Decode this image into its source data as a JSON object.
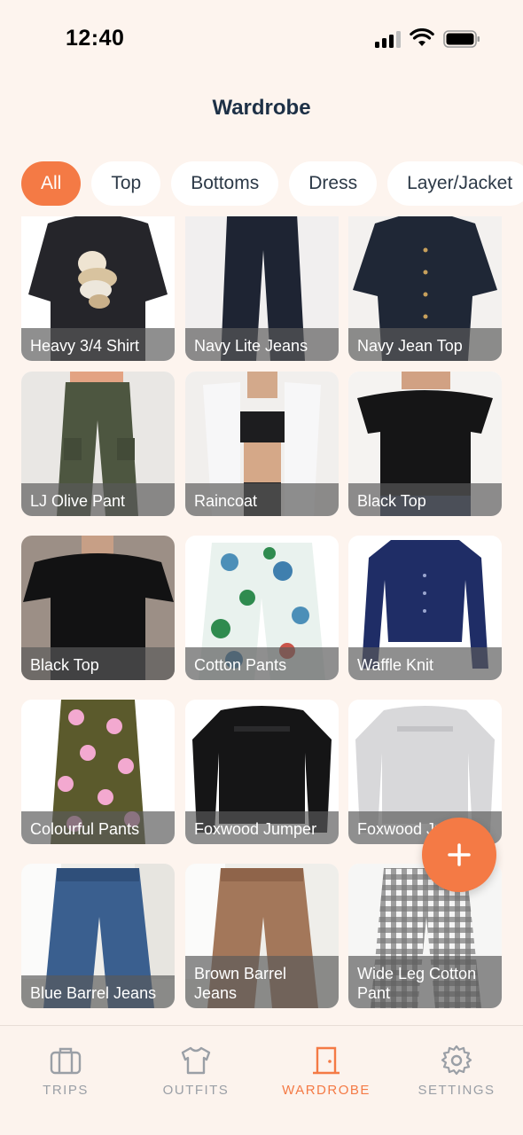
{
  "status_bar": {
    "time": "12:40"
  },
  "header": {
    "title": "Wardrobe"
  },
  "filters": [
    {
      "label": "All",
      "active": true
    },
    {
      "label": "Top",
      "active": false
    },
    {
      "label": "Bottoms",
      "active": false
    },
    {
      "label": "Dress",
      "active": false
    },
    {
      "label": "Layer/Jacket",
      "active": false
    }
  ],
  "items": [
    {
      "name": "Heavy 3/4 Shirt"
    },
    {
      "name": "Navy Lite Jeans"
    },
    {
      "name": "Navy Jean Top"
    },
    {
      "name": "LJ Olive Pant"
    },
    {
      "name": "Raincoat"
    },
    {
      "name": "Black Top"
    },
    {
      "name": "Black Top"
    },
    {
      "name": "Cotton Pants"
    },
    {
      "name": "Waffle Knit"
    },
    {
      "name": "Colourful Pants"
    },
    {
      "name": "Foxwood Jumper"
    },
    {
      "name": "Foxwood Jumper"
    },
    {
      "name": "Blue Barrel Jeans"
    },
    {
      "name": "Brown Barrel Jeans"
    },
    {
      "name": "Wide Leg Cotton Pant"
    }
  ],
  "fab": {
    "icon": "plus-icon"
  },
  "tabbar": [
    {
      "label": "TRIPS",
      "icon": "suitcase-icon",
      "active": false
    },
    {
      "label": "OUTFITS",
      "icon": "shirt-icon",
      "active": false
    },
    {
      "label": "WARDROBE",
      "icon": "wardrobe-icon",
      "active": true
    },
    {
      "label": "SETTINGS",
      "icon": "gear-icon",
      "active": false
    }
  ],
  "colors": {
    "accent": "#f47a45",
    "background": "#fdf4ee",
    "title": "#1d3046"
  }
}
